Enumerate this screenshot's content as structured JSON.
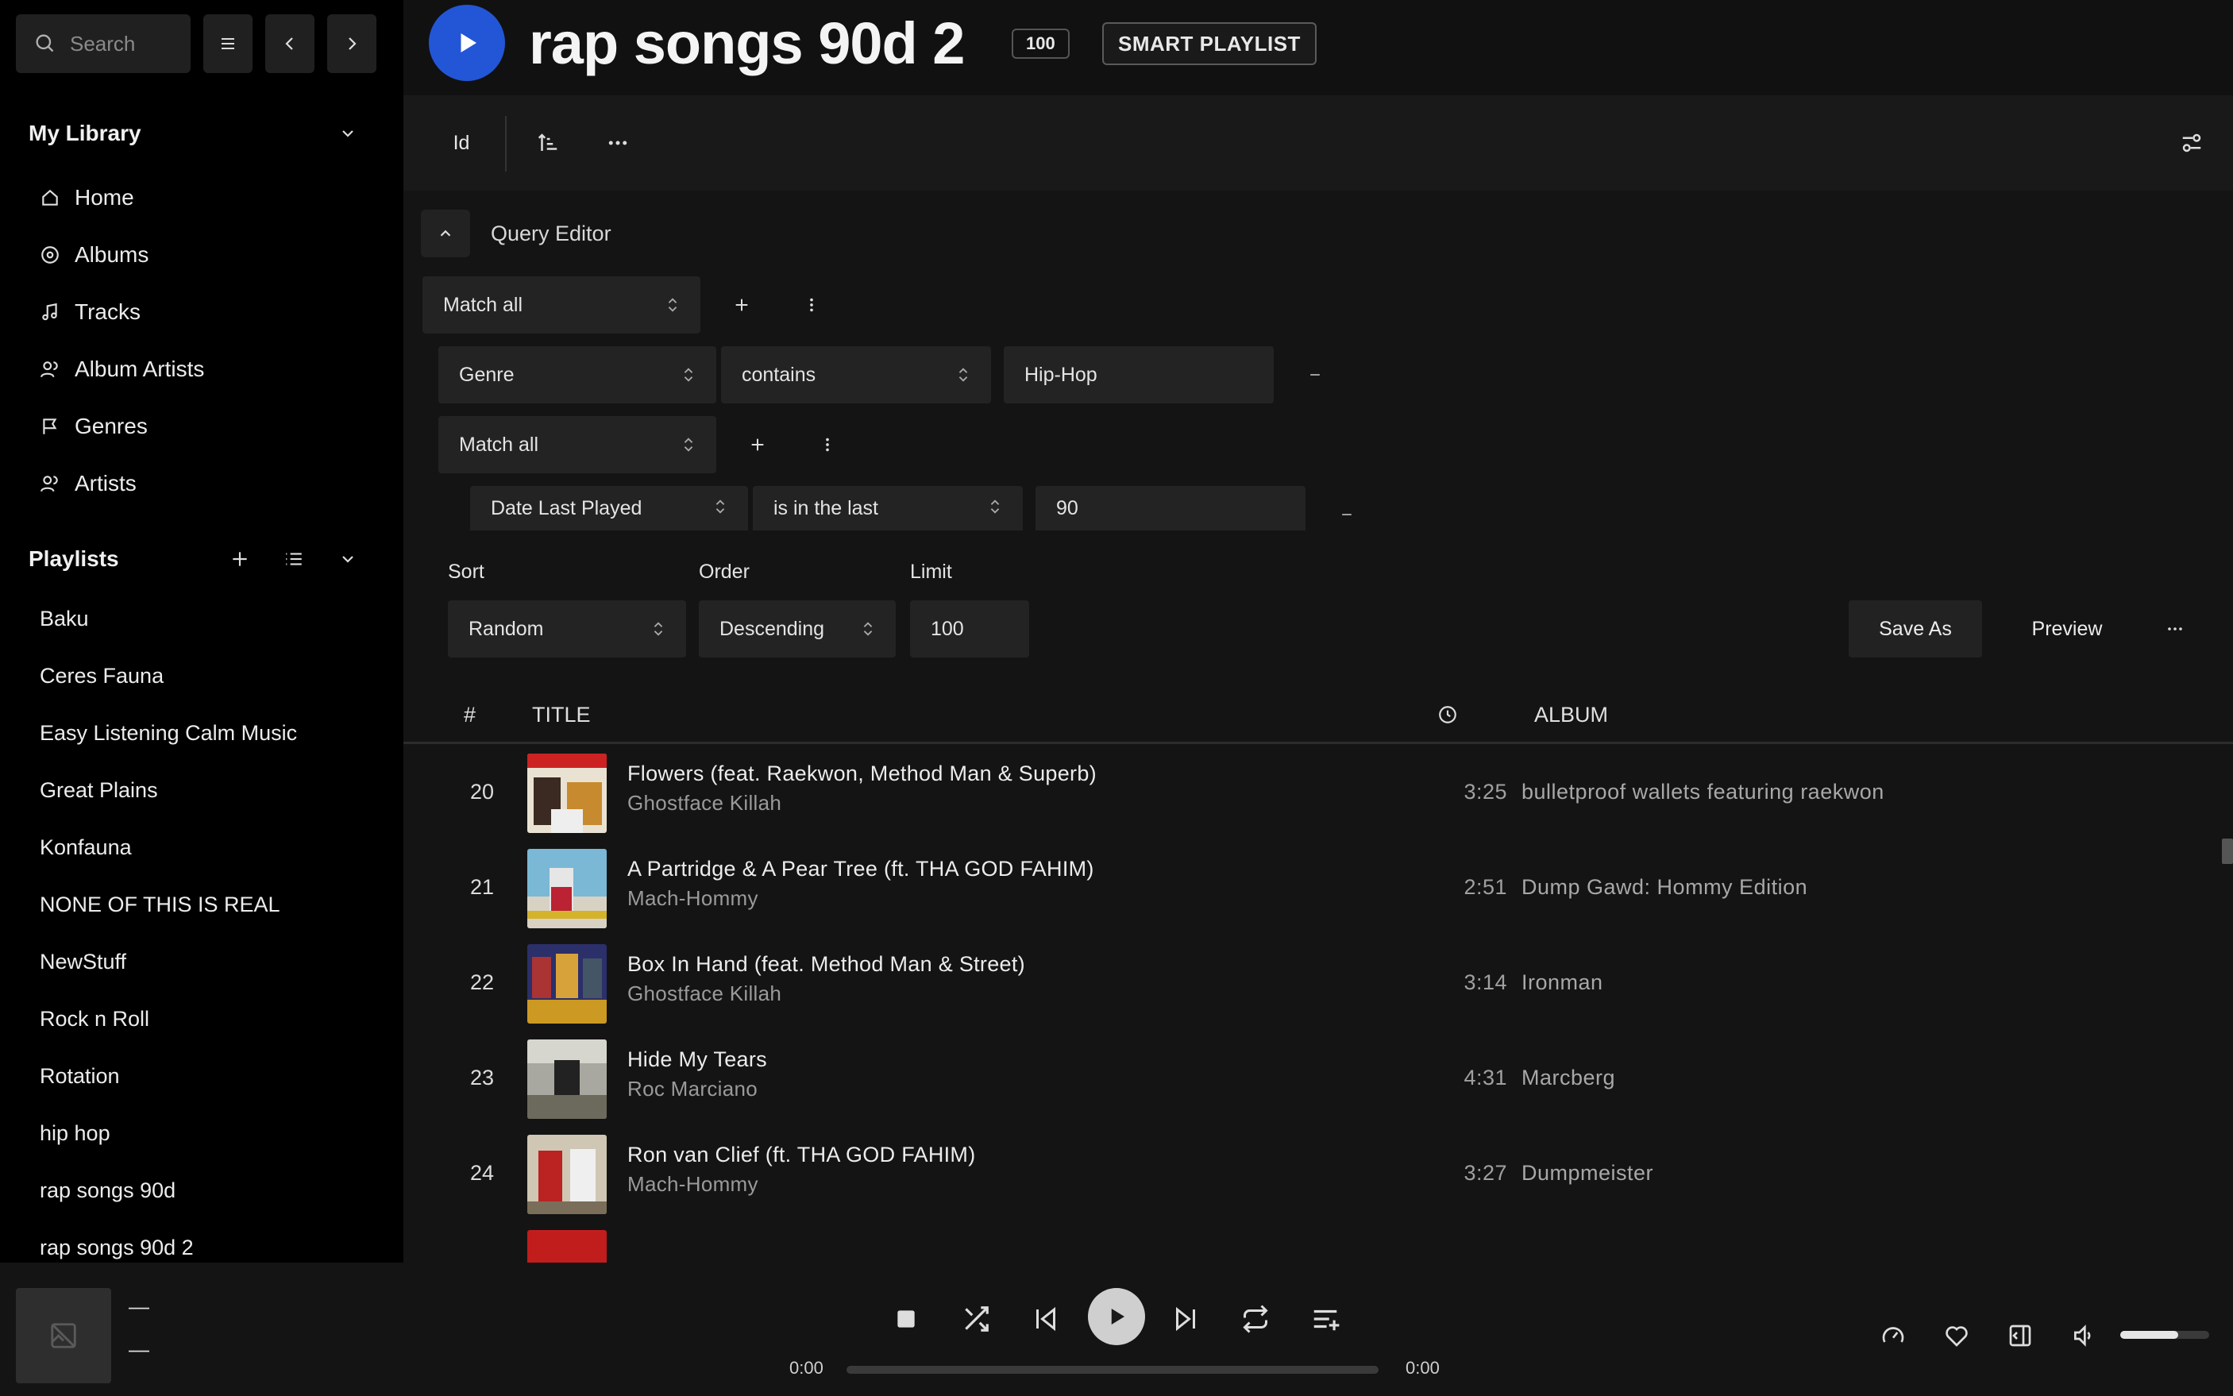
{
  "sidebar": {
    "search_placeholder": "Search",
    "library_title": "My Library",
    "nav": [
      {
        "label": "Home",
        "icon": "home-icon"
      },
      {
        "label": "Albums",
        "icon": "album-disc-icon"
      },
      {
        "label": "Tracks",
        "icon": "music-note-icon"
      },
      {
        "label": "Album Artists",
        "icon": "users-icon"
      },
      {
        "label": "Genres",
        "icon": "flag-icon"
      },
      {
        "label": "Artists",
        "icon": "users-icon"
      }
    ],
    "playlists_title": "Playlists",
    "playlists": [
      "Baku",
      "Ceres Fauna",
      "Easy Listening Calm Music",
      "Great Plains",
      "Konfauna",
      "NONE OF THIS IS REAL",
      "NewStuff",
      "Rock n Roll",
      "Rotation",
      "hip hop",
      "rap songs 90d",
      "rap songs 90d 2"
    ]
  },
  "header": {
    "title": "rap songs 90d 2",
    "count": "100",
    "badge": "SMART PLAYLIST"
  },
  "toolbar": {
    "id_label": "Id"
  },
  "query": {
    "label": "Query Editor",
    "match1": "Match all",
    "rule1": {
      "field": "Genre",
      "operator": "contains",
      "value": "Hip-Hop"
    },
    "match2": "Match all",
    "rule2": {
      "field": "Date Last Played",
      "operator": "is in the last",
      "value": "90"
    },
    "sort_label": "Sort",
    "order_label": "Order",
    "limit_label": "Limit",
    "sort": "Random",
    "order": "Descending",
    "limit": "100",
    "save_as": "Save As",
    "preview": "Preview"
  },
  "table": {
    "col_num": "#",
    "col_title": "TITLE",
    "col_album": "ALBUM",
    "rows": [
      {
        "num": "20",
        "title": "Flowers (feat. Raekwon, Method Man & Superb)",
        "artist": "Ghostface Killah",
        "duration": "3:25",
        "album": "bulletproof wallets featuring raekwon"
      },
      {
        "num": "21",
        "title": "A Partridge & A Pear Tree (ft. THA GOD FAHIM)",
        "artist": "Mach-Hommy",
        "duration": "2:51",
        "album": "Dump Gawd: Hommy Edition"
      },
      {
        "num": "22",
        "title": "Box In Hand (feat. Method Man & Street)",
        "artist": "Ghostface Killah",
        "duration": "3:14",
        "album": "Ironman"
      },
      {
        "num": "23",
        "title": "Hide My Tears",
        "artist": "Roc Marciano",
        "duration": "4:31",
        "album": "Marcberg"
      },
      {
        "num": "24",
        "title": "Ron van Clief (ft. THA GOD FAHIM)",
        "artist": "Mach-Hommy",
        "duration": "3:27",
        "album": "Dumpmeister"
      }
    ]
  },
  "player": {
    "track_title": "—",
    "track_artist": "—",
    "time_current": "0:00",
    "time_total": "0:00",
    "progress": 0,
    "volume": 0.65
  },
  "colors": {
    "accent": "#2256d6",
    "sidebar_bg": "#000000",
    "main_bg": "#141414"
  }
}
